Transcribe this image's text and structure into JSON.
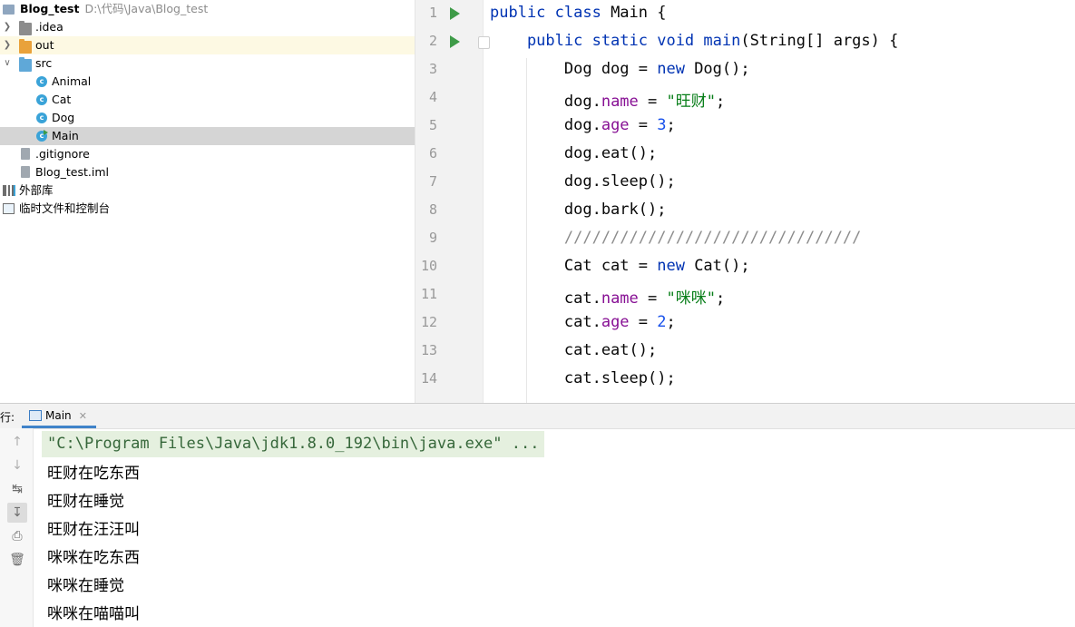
{
  "project": {
    "root_name": "Blog_test",
    "root_path": "D:\\代码\\Java\\Blog_test",
    "items": [
      {
        "label": "Blog_test",
        "kind": "module-root"
      },
      {
        "label": ".idea",
        "kind": "folder"
      },
      {
        "label": "out",
        "kind": "folder-excluded"
      },
      {
        "label": "src",
        "kind": "folder-source"
      },
      {
        "label": "Animal",
        "kind": "class"
      },
      {
        "label": "Cat",
        "kind": "class"
      },
      {
        "label": "Dog",
        "kind": "class"
      },
      {
        "label": "Main",
        "kind": "class-main"
      },
      {
        "label": ".gitignore",
        "kind": "file"
      },
      {
        "label": "Blog_test.iml",
        "kind": "file"
      },
      {
        "label": "外部库",
        "kind": "libraries"
      },
      {
        "label": "临时文件和控制台",
        "kind": "scratches"
      }
    ]
  },
  "editor": {
    "line_numbers": [
      "1",
      "2",
      "3",
      "4",
      "5",
      "6",
      "7",
      "8",
      "9",
      "10",
      "11",
      "12",
      "13",
      "14"
    ],
    "lines": [
      [
        {
          "t": "public class ",
          "c": "kw"
        },
        {
          "t": "Main {",
          "c": ""
        }
      ],
      [
        {
          "t": "    public static void ",
          "c": "kw"
        },
        {
          "t": "main",
          "c": "kw"
        },
        {
          "t": "(String[] args) {",
          "c": ""
        }
      ],
      [
        {
          "t": "        Dog dog = ",
          "c": ""
        },
        {
          "t": "new ",
          "c": "kw"
        },
        {
          "t": "Dog();",
          "c": ""
        }
      ],
      [
        {
          "t": "        dog.",
          "c": ""
        },
        {
          "t": "name",
          "c": "fld"
        },
        {
          "t": " = ",
          "c": ""
        },
        {
          "t": "\"旺财\"",
          "c": "str"
        },
        {
          "t": ";",
          "c": ""
        }
      ],
      [
        {
          "t": "        dog.",
          "c": ""
        },
        {
          "t": "age",
          "c": "fld"
        },
        {
          "t": " = ",
          "c": ""
        },
        {
          "t": "3",
          "c": "num"
        },
        {
          "t": ";",
          "c": ""
        }
      ],
      [
        {
          "t": "        dog.eat();",
          "c": ""
        }
      ],
      [
        {
          "t": "        dog.sleep();",
          "c": ""
        }
      ],
      [
        {
          "t": "        dog.bark();",
          "c": ""
        }
      ],
      [
        {
          "t": "        ////////////////////////////////",
          "c": "cmt"
        }
      ],
      [
        {
          "t": "        Cat cat = ",
          "c": ""
        },
        {
          "t": "new ",
          "c": "kw"
        },
        {
          "t": "Cat();",
          "c": ""
        }
      ],
      [
        {
          "t": "        cat.",
          "c": ""
        },
        {
          "t": "name",
          "c": "fld"
        },
        {
          "t": " = ",
          "c": ""
        },
        {
          "t": "\"咪咪\"",
          "c": "str"
        },
        {
          "t": ";",
          "c": ""
        }
      ],
      [
        {
          "t": "        cat.",
          "c": ""
        },
        {
          "t": "age",
          "c": "fld"
        },
        {
          "t": " = ",
          "c": ""
        },
        {
          "t": "2",
          "c": "num"
        },
        {
          "t": ";",
          "c": ""
        }
      ],
      [
        {
          "t": "        cat.eat();",
          "c": ""
        }
      ],
      [
        {
          "t": "        cat.sleep();",
          "c": ""
        }
      ]
    ],
    "run_gutter_lines": [
      "1",
      "2"
    ]
  },
  "run_panel": {
    "label": "行:",
    "tab_label": "Main",
    "command": "\"C:\\Program Files\\Java\\jdk1.8.0_192\\bin\\java.exe\" ...",
    "output": [
      "旺财在吃东西",
      "旺财在睡觉",
      "旺财在汪汪叫",
      "咪咪在吃东西",
      "咪咪在睡觉",
      "咪咪在喵喵叫"
    ]
  },
  "colors": {
    "keyword": "#0033b3",
    "field": "#871094",
    "string": "#067d17",
    "number": "#1750eb",
    "comment": "#8c8c8c",
    "run_icon": "#3e9b48",
    "selection": "#d5d5d5"
  }
}
